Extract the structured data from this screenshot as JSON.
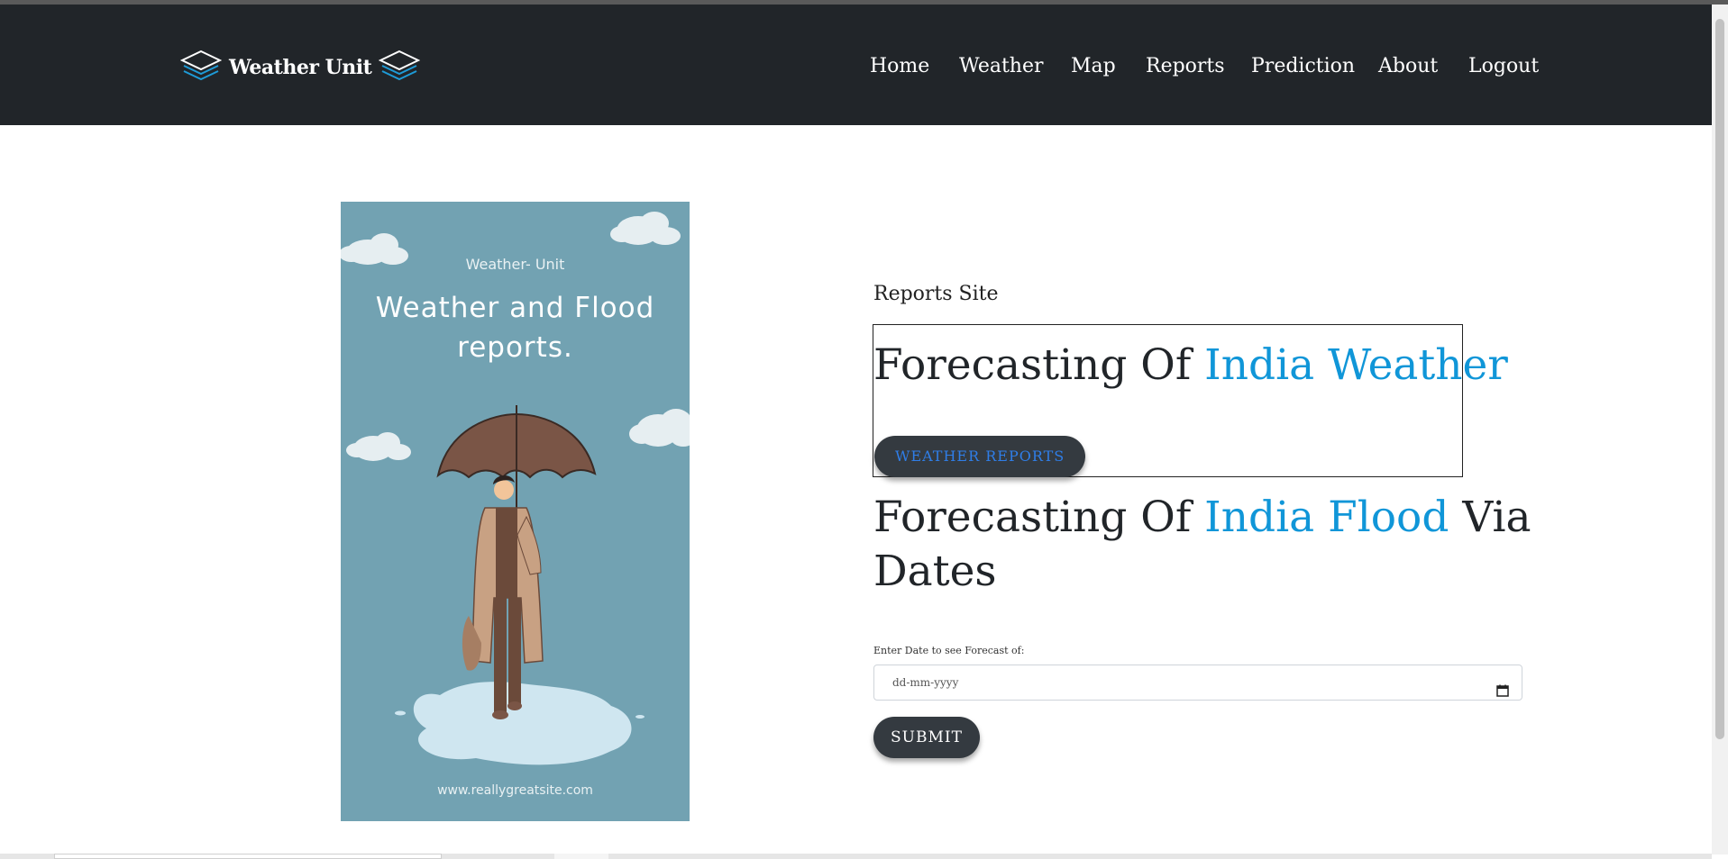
{
  "navbar": {
    "brand": "Weather Unit",
    "items": [
      {
        "label": "Home"
      },
      {
        "label": "Weather"
      },
      {
        "label": "Map"
      },
      {
        "label": "Reports"
      },
      {
        "label": "Prediction"
      },
      {
        "label": "About"
      },
      {
        "label": "Logout"
      }
    ]
  },
  "poster": {
    "small_title": "Weather- Unit",
    "title_line1": "Weather and Flood",
    "title_line2": "reports.",
    "url": "www.reallygreatsite.com"
  },
  "main": {
    "subtitle": "Reports Site",
    "heading1_prefix": "Forecasting Of ",
    "heading1_accent": "India Weather",
    "weather_reports_button": "WEATHER REPORTS",
    "heading2_prefix": "Forecasting Of ",
    "heading2_accent": "India Flood",
    "heading2_suffix": " Via",
    "heading2_line2": "Dates",
    "date_label": "Enter Date to see Forecast of:",
    "date_placeholder": "dd-mm-yyyy",
    "submit": "SUBMIT"
  },
  "colors": {
    "navbar_bg": "#212529",
    "accent": "#1096d8",
    "button_bg": "#343a40",
    "poster_bg": "#72a2b2",
    "brand_icon": "#1e9bd7"
  },
  "icons": {
    "brand_left": "layers-icon",
    "brand_right": "layers-icon",
    "date_picker": "calendar-icon"
  }
}
